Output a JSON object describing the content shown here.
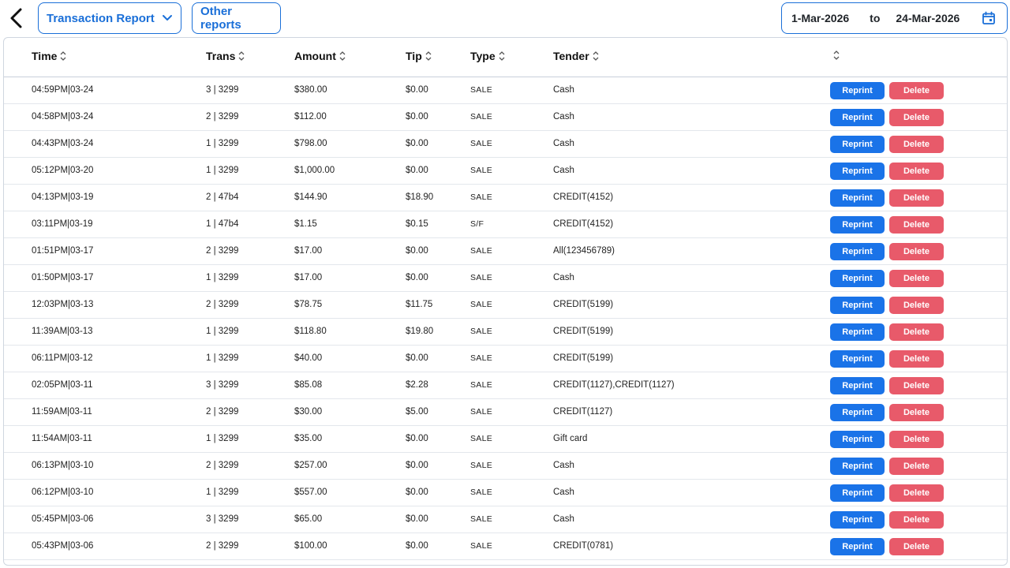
{
  "header": {
    "report_select": "Transaction Report",
    "other_reports": "Other reports",
    "date_from": "1-Mar-2026",
    "date_to_label": "to",
    "date_to": "24-Mar-2026"
  },
  "columns": {
    "time": "Time",
    "trans": "Trans",
    "amount": "Amount",
    "tip": "Tip",
    "type": "Type",
    "tender": "Tender"
  },
  "actions": {
    "reprint": "Reprint",
    "delete": "Delete"
  },
  "rows": [
    {
      "time": "04:59PM|03-24",
      "trans": "3 | 3299",
      "amount": "$380.00",
      "tip": "$0.00",
      "type": "SALE",
      "tender": "Cash"
    },
    {
      "time": "04:58PM|03-24",
      "trans": "2 | 3299",
      "amount": "$112.00",
      "tip": "$0.00",
      "type": "SALE",
      "tender": "Cash"
    },
    {
      "time": "04:43PM|03-24",
      "trans": "1 | 3299",
      "amount": "$798.00",
      "tip": "$0.00",
      "type": "SALE",
      "tender": "Cash"
    },
    {
      "time": "05:12PM|03-20",
      "trans": "1 | 3299",
      "amount": "$1,000.00",
      "tip": "$0.00",
      "type": "SALE",
      "tender": "Cash"
    },
    {
      "time": "04:13PM|03-19",
      "trans": "2 | 47b4",
      "amount": "$144.90",
      "tip": "$18.90",
      "type": "SALE",
      "tender": "CREDIT(4152)"
    },
    {
      "time": "03:11PM|03-19",
      "trans": "1 | 47b4",
      "amount": "$1.15",
      "tip": "$0.15",
      "type": "S/F",
      "tender": "CREDIT(4152)"
    },
    {
      "time": "01:51PM|03-17",
      "trans": "2 | 3299",
      "amount": "$17.00",
      "tip": "$0.00",
      "type": "SALE",
      "tender": "All(123456789)"
    },
    {
      "time": "01:50PM|03-17",
      "trans": "1 | 3299",
      "amount": "$17.00",
      "tip": "$0.00",
      "type": "SALE",
      "tender": "Cash"
    },
    {
      "time": "12:03PM|03-13",
      "trans": "2 | 3299",
      "amount": "$78.75",
      "tip": "$11.75",
      "type": "SALE",
      "tender": "CREDIT(5199)"
    },
    {
      "time": "11:39AM|03-13",
      "trans": "1 | 3299",
      "amount": "$118.80",
      "tip": "$19.80",
      "type": "SALE",
      "tender": "CREDIT(5199)"
    },
    {
      "time": "06:11PM|03-12",
      "trans": "1 | 3299",
      "amount": "$40.00",
      "tip": "$0.00",
      "type": "SALE",
      "tender": "CREDIT(5199)"
    },
    {
      "time": "02:05PM|03-11",
      "trans": "3 | 3299",
      "amount": "$85.08",
      "tip": "$2.28",
      "type": "SALE",
      "tender": "CREDIT(1127),CREDIT(1127)"
    },
    {
      "time": "11:59AM|03-11",
      "trans": "2 | 3299",
      "amount": "$30.00",
      "tip": "$5.00",
      "type": "SALE",
      "tender": "CREDIT(1127)"
    },
    {
      "time": "11:54AM|03-11",
      "trans": "1 | 3299",
      "amount": "$35.00",
      "tip": "$0.00",
      "type": "SALE",
      "tender": "Gift card"
    },
    {
      "time": "06:13PM|03-10",
      "trans": "2 | 3299",
      "amount": "$257.00",
      "tip": "$0.00",
      "type": "SALE",
      "tender": "Cash"
    },
    {
      "time": "06:12PM|03-10",
      "trans": "1 | 3299",
      "amount": "$557.00",
      "tip": "$0.00",
      "type": "SALE",
      "tender": "Cash"
    },
    {
      "time": "05:45PM|03-06",
      "trans": "3 | 3299",
      "amount": "$65.00",
      "tip": "$0.00",
      "type": "SALE",
      "tender": "Cash"
    },
    {
      "time": "05:43PM|03-06",
      "trans": "2 | 3299",
      "amount": "$100.00",
      "tip": "$0.00",
      "type": "SALE",
      "tender": "CREDIT(0781)"
    }
  ]
}
